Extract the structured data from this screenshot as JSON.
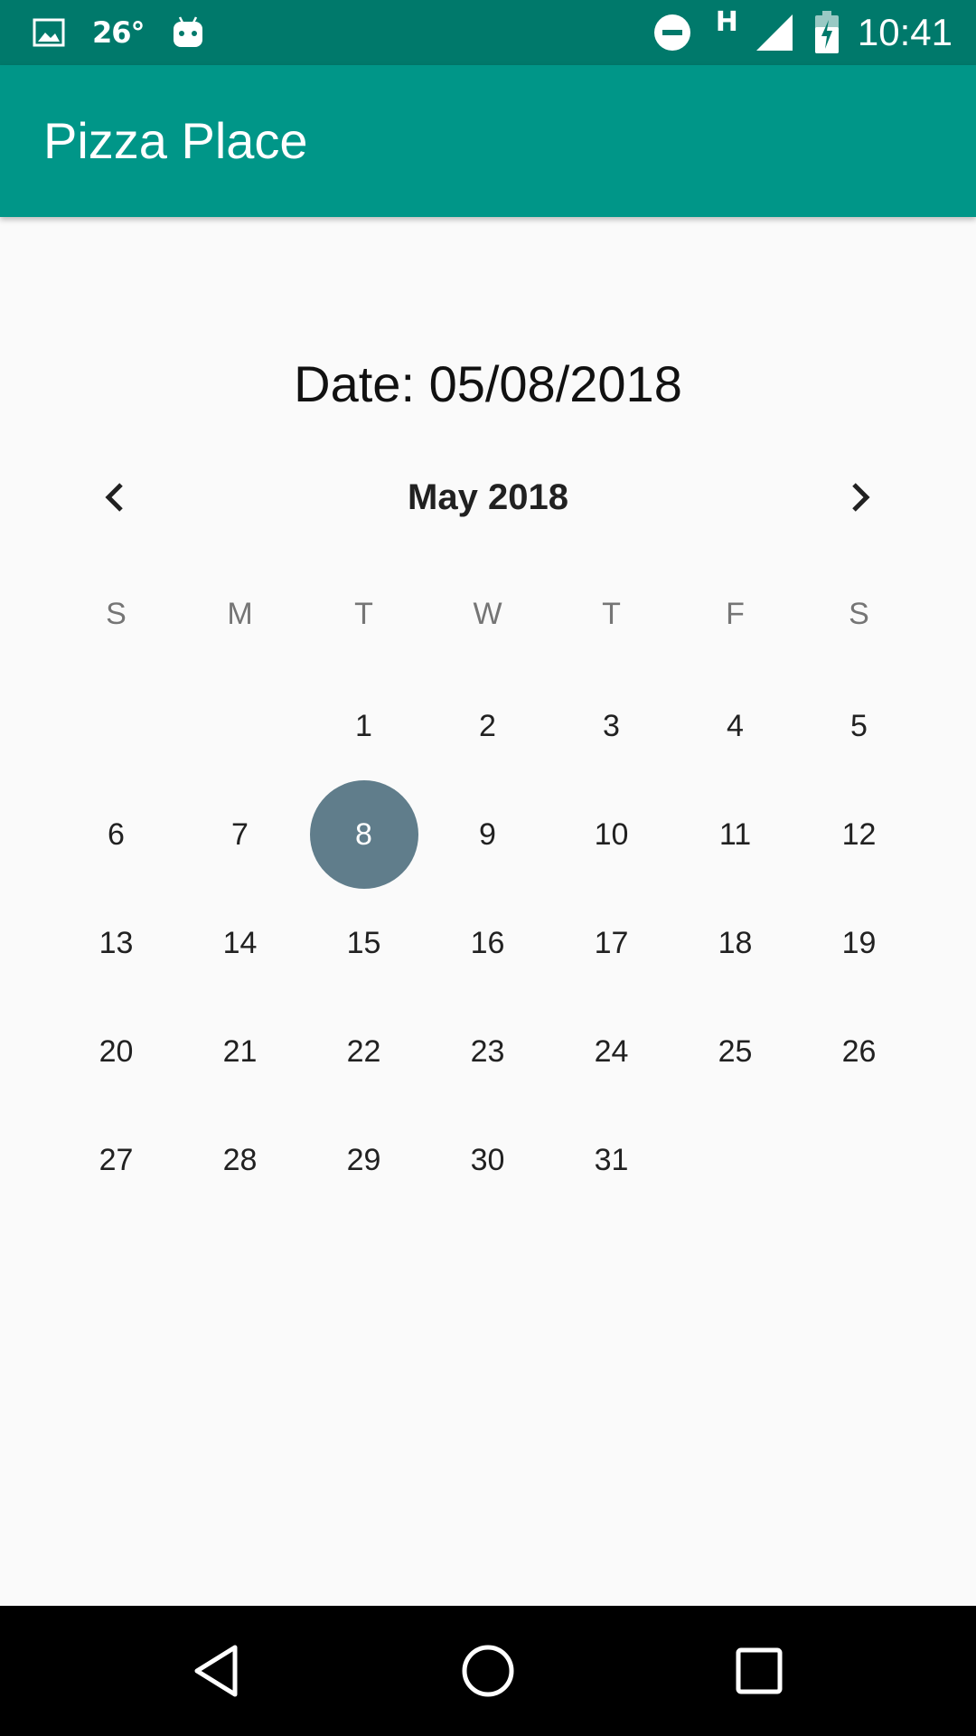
{
  "status_bar": {
    "temperature": "26°",
    "network": "H",
    "time": "10:41",
    "icons": [
      "image-icon",
      "android-icon",
      "do-not-disturb-icon",
      "signal-icon",
      "battery-charging-icon"
    ]
  },
  "app_bar": {
    "title": "Pizza Place"
  },
  "date_label": "Date: 05/08/2018",
  "calendar": {
    "month_label": "May 2018",
    "prev_icon": "chevron-left-icon",
    "next_icon": "chevron-right-icon",
    "weekdays": [
      "S",
      "M",
      "T",
      "W",
      "T",
      "F",
      "S"
    ],
    "days": [
      "",
      "",
      "1",
      "2",
      "3",
      "4",
      "5",
      "6",
      "7",
      "8",
      "9",
      "10",
      "11",
      "12",
      "13",
      "14",
      "15",
      "16",
      "17",
      "18",
      "19",
      "20",
      "21",
      "22",
      "23",
      "24",
      "25",
      "26",
      "27",
      "28",
      "29",
      "30",
      "31",
      "",
      ""
    ],
    "selected_day": "8",
    "selected_color": "#607d8b"
  },
  "colors": {
    "status_bar": "#00796b",
    "app_bar": "#009688",
    "background": "#fafafa"
  },
  "nav_bar": {
    "icons": [
      "back-icon",
      "home-icon",
      "recents-icon"
    ]
  }
}
